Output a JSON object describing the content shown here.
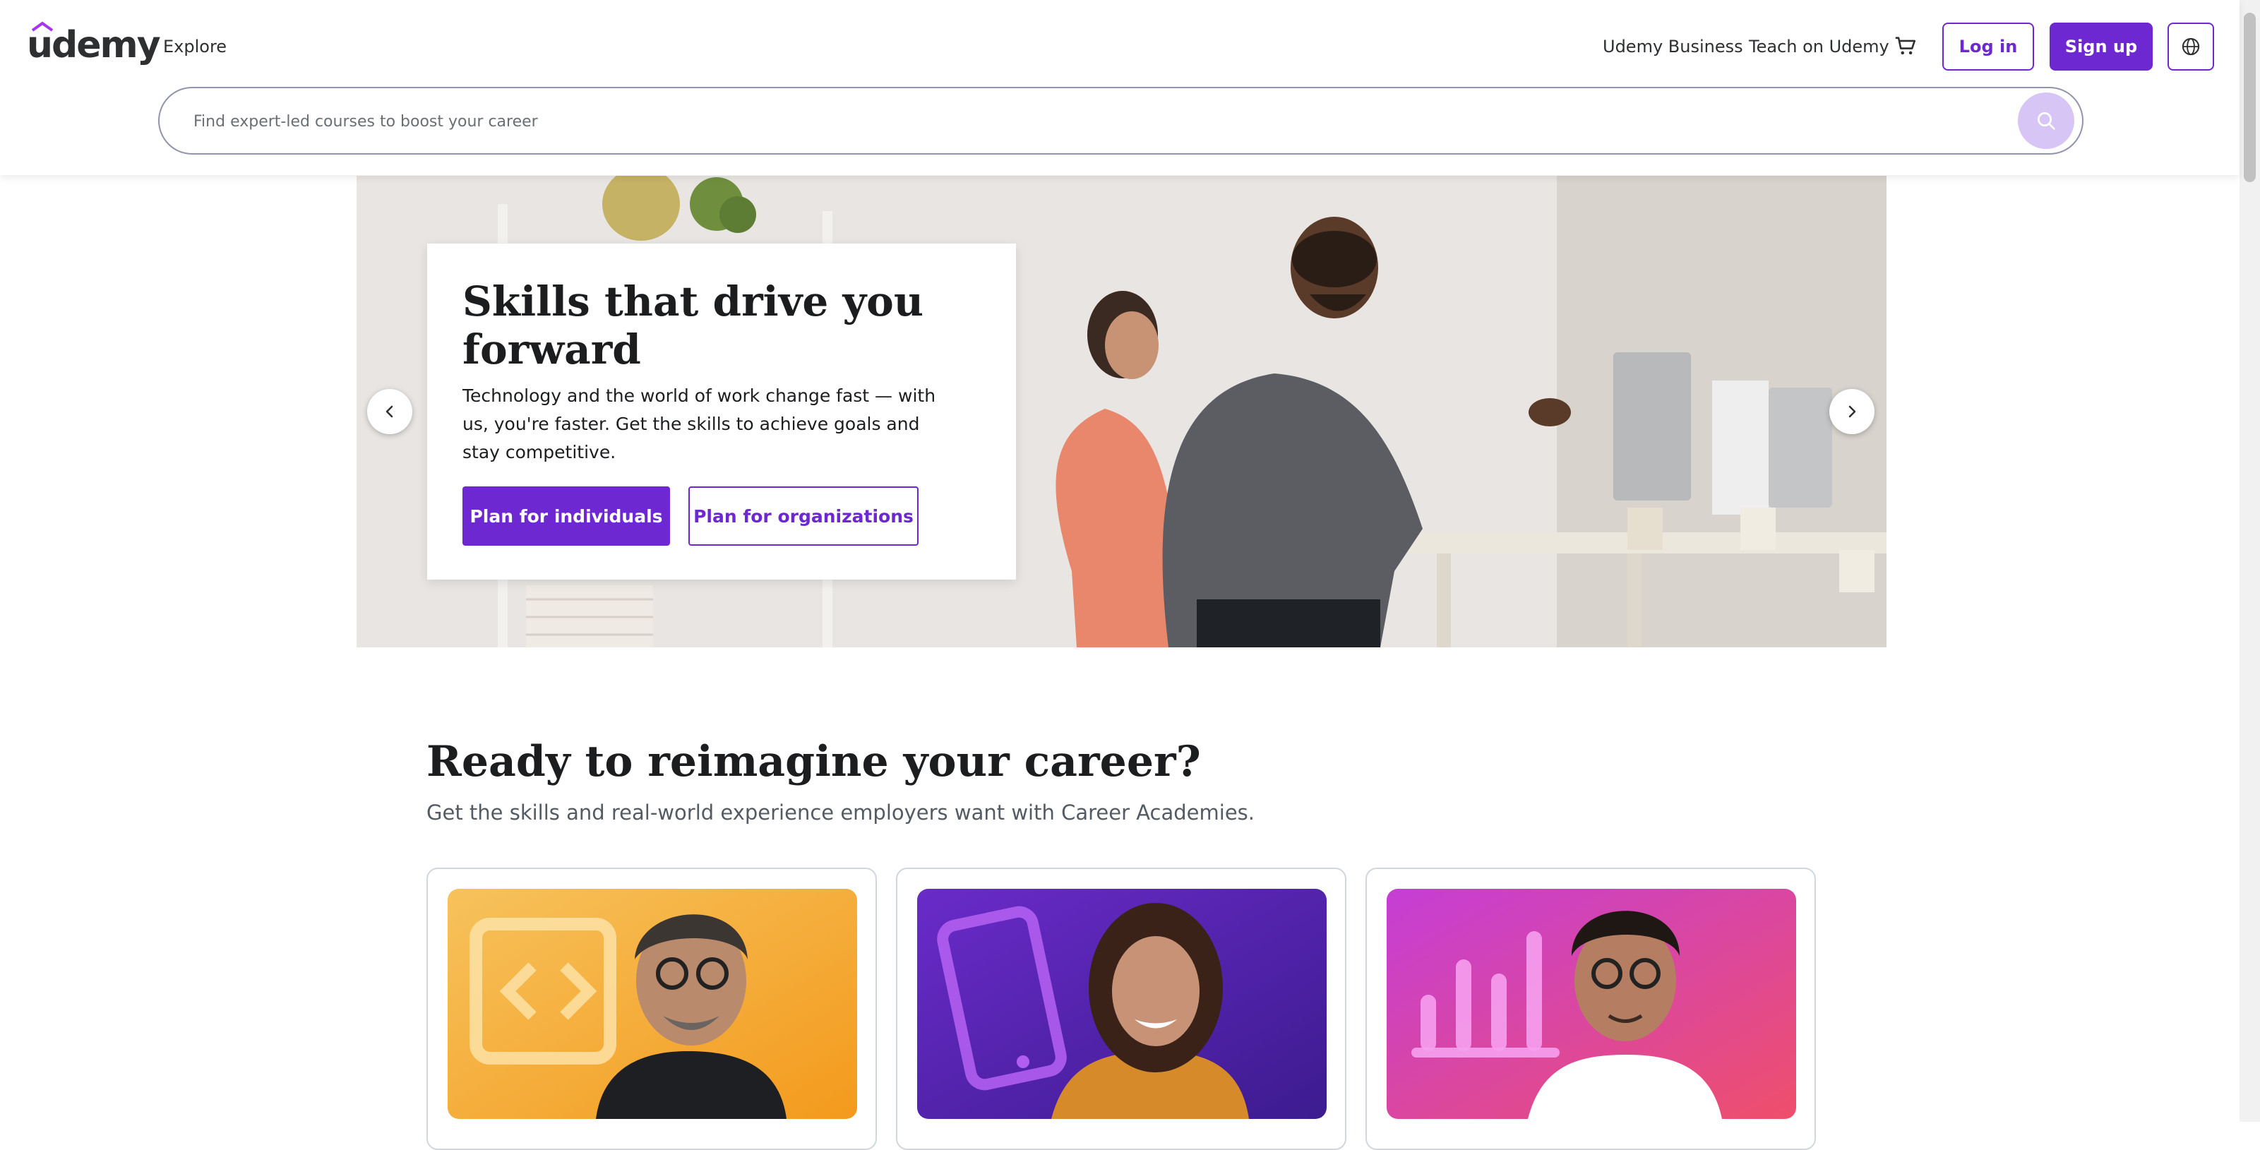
{
  "header": {
    "logo": "udemy",
    "explore": "Explore",
    "business": "Udemy Business",
    "teach": "Teach on Udemy",
    "login": "Log in",
    "signup": "Sign up",
    "cart_icon": "cart-icon",
    "globe_icon": "globe-icon"
  },
  "search": {
    "placeholder": "Find expert-led courses to boost your career",
    "icon": "search-icon"
  },
  "hero": {
    "title": "Skills that drive you forward",
    "description": "Technology and the world of work change fast — with us, you're faster. Get the skills to achieve goals and stay competitive.",
    "btn_individuals": "Plan for individuals",
    "btn_organizations": "Plan for organizations"
  },
  "section": {
    "title": "Ready to reimagine your career?",
    "subtitle": "Get the skills and real-world experience employers want with Career Academies."
  },
  "colors": {
    "brand": "#6d28d2",
    "text": "#1c1d1f"
  }
}
